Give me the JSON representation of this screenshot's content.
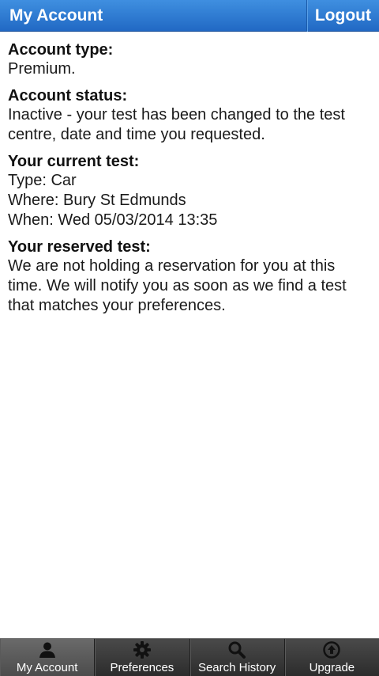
{
  "header": {
    "title": "My Account",
    "logout_label": "Logout"
  },
  "sections": {
    "account_type": {
      "heading": "Account type:",
      "body": "Premium."
    },
    "account_status": {
      "heading": "Account status:",
      "body": "Inactive - your test has been changed to the test centre, date and time you requested."
    },
    "current_test": {
      "heading": "Your current test:",
      "type": "Type: Car",
      "where": "Where: Bury St Edmunds",
      "when": "When: Wed 05/03/2014 13:35"
    },
    "reserved_test": {
      "heading": "Your reserved test:",
      "body": "We are not holding a reservation for you at this time.  We will notify you as soon as we find a test that matches your preferences."
    }
  },
  "tabs": [
    {
      "label": "My Account",
      "icon": "person-icon",
      "active": true
    },
    {
      "label": "Preferences",
      "icon": "gear-icon",
      "active": false
    },
    {
      "label": "Search History",
      "icon": "search-icon",
      "active": false
    },
    {
      "label": "Upgrade",
      "icon": "upgrade-arrow-icon",
      "active": false
    }
  ],
  "colors": {
    "header_blue": "#2f7fd6",
    "tabbar_dark": "#333333",
    "text": "#1a1a1a"
  }
}
